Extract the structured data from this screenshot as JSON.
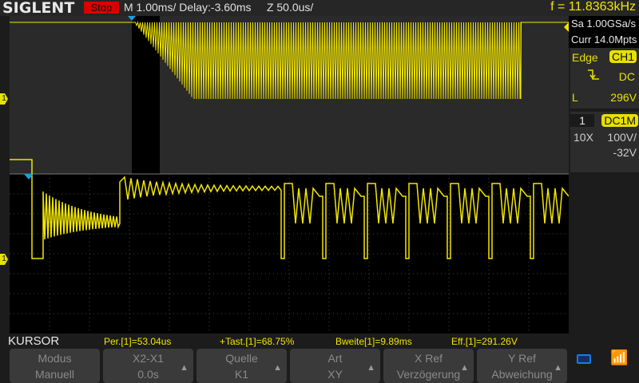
{
  "header": {
    "brand": "SIGLENT",
    "run_state": "Stop",
    "timebase": "M 1.00ms/ Delay:-3.60ms",
    "zoom": "Z 50.0us/",
    "frequency": "f = 11.8363kHz"
  },
  "acquisition": {
    "sample_rate": "Sa 1.00GSa/s",
    "memory": "Curr 14.0Mpts"
  },
  "trigger": {
    "type": "Edge",
    "source": "CH1",
    "slope_icon": "falling-edge-icon",
    "coupling": "DC",
    "level_label": "L",
    "level": "296V"
  },
  "channel": {
    "number": "1",
    "coupling": "DC1M",
    "probe": "10X",
    "scale": "100V/",
    "offset": "-32V"
  },
  "markers": {
    "ch1": "1"
  },
  "cursor_bar": {
    "title": "KURSOR",
    "measurements": [
      "Per.[1]=53.04us",
      "+Tast.[1]=68.75%",
      "Bweite[1]=9.89ms",
      "Eff.[1]=291.26V"
    ]
  },
  "softkeys": [
    {
      "top": "Modus",
      "bottom": "Manuell",
      "arrow": false
    },
    {
      "top": "X2-X1",
      "bottom": "0.0s",
      "arrow": true
    },
    {
      "top": "Quelle",
      "bottom": "K1",
      "arrow": true
    },
    {
      "top": "Art",
      "bottom": "XY",
      "arrow": true
    },
    {
      "top": "X Ref",
      "bottom": "Verzögerung",
      "arrow": true
    },
    {
      "top": "Y Ref",
      "bottom": "Abweichung",
      "arrow": true
    }
  ],
  "colors": {
    "ch1": "#f2e600",
    "trigger": "#19a0e0",
    "stop": "#d90000"
  }
}
